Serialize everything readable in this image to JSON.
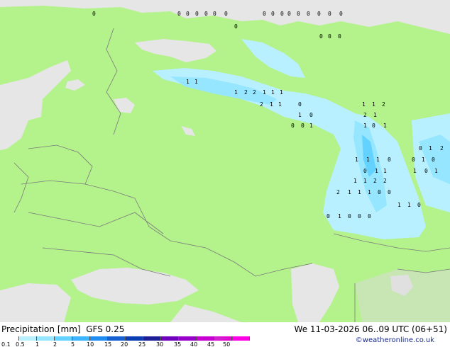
{
  "legend": {
    "title": "Precipitation [mm]",
    "model": "GFS 0.25",
    "valid": "We 11-03-2026 06..09 UTC (06+51)",
    "credit": "©weatheronline.co.uk",
    "ticks": [
      "0.1",
      "0.5",
      "1",
      "2",
      "5",
      "10",
      "15",
      "20",
      "25",
      "30",
      "35",
      "40",
      "45",
      "50"
    ],
    "colors": [
      "#ffffff",
      "#b8f0ff",
      "#96e6ff",
      "#64d2ff",
      "#3cb4ff",
      "#1e8cf0",
      "#1460d2",
      "#0a3cb4",
      "#1e1e96",
      "#6e00be",
      "#9600c8",
      "#c800d2",
      "#e600d2",
      "#ff00e6"
    ]
  },
  "colors": {
    "land": "#b4f28c",
    "sea": "#e6e6e6",
    "border": "#a0a0a0",
    "precip_light": "#b8f0ff",
    "precip_mid": "#96e6ff",
    "precip_heavy": "#64d2ff"
  },
  "map_labels": [
    "0",
    "0",
    "0",
    "0",
    "0",
    "0",
    "0",
    "0",
    "0",
    "0",
    "0",
    "0",
    "0",
    "0",
    "0",
    "0",
    "0",
    "0",
    "0",
    "0",
    "1",
    "1",
    "1",
    "2",
    "2",
    "1",
    "1",
    "1",
    "2",
    "1",
    "1",
    "0",
    "1",
    "1",
    "2",
    "1",
    "0",
    "2",
    "1",
    "0",
    "0",
    "1",
    "1",
    "0",
    "1",
    "0",
    "1",
    "2",
    "1",
    "1",
    "1",
    "0",
    "0",
    "1",
    "0",
    "0",
    "1",
    "1",
    "1",
    "0",
    "1",
    "1",
    "1",
    "2",
    "2",
    "2",
    "1",
    "1",
    "1",
    "0",
    "0",
    "1",
    "1",
    "0",
    "0",
    "1",
    "0",
    "0",
    "0"
  ]
}
